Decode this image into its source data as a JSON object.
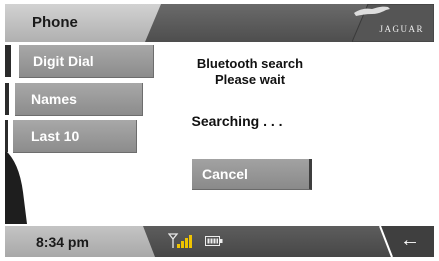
{
  "header": {
    "title": "Phone",
    "brand": "JAGUAR"
  },
  "menu": {
    "items": [
      {
        "label": "Digit Dial"
      },
      {
        "label": "Names"
      },
      {
        "label": "Last 10"
      }
    ]
  },
  "content": {
    "line1": "Bluetooth search",
    "line2": "Please wait",
    "status": "Searching . . .",
    "cancel_label": "Cancel"
  },
  "status_bar": {
    "time": "8:34 pm",
    "back_label": "←",
    "icons": [
      "signal-strength-icon",
      "battery-icon"
    ]
  },
  "colors": {
    "bar_dark": "#4e4e4e",
    "button_gray": "#999999",
    "tab_light": "#bdbdbd",
    "text_white": "#ffffff"
  }
}
